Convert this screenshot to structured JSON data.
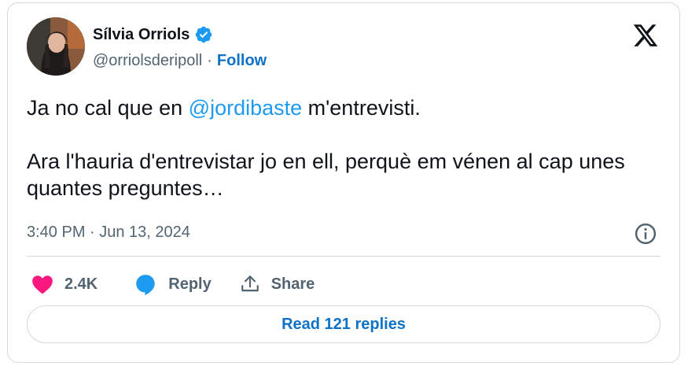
{
  "author": {
    "name": "Sílvia Orriols",
    "handle": "@orriolsderipoll",
    "separator": "·",
    "follow_label": "Follow",
    "verified_color": "#1d9bf0"
  },
  "tweet": {
    "line1_before": "Ja no cal que en ",
    "mention": "@jordibaste",
    "line1_after": " m'entrevisti.",
    "paragraph2": "Ara l'hauria d'entrevistar jo en ell, perquè em vénen al cap unes quantes preguntes…",
    "timestamp": "3:40 PM · Jun 13, 2024"
  },
  "actions": {
    "like_count": "2.4K",
    "reply_label": "Reply",
    "share_label": "Share",
    "like_color": "#f91880",
    "reply_color": "#1d9bf0"
  },
  "footer": {
    "read_replies_label": "Read 121 replies"
  },
  "icons": {
    "logo": "x-logo-icon",
    "info": "info-icon",
    "like": "heart-icon",
    "reply": "speech-bubble-icon",
    "share": "share-icon",
    "verified": "verified-badge-icon"
  }
}
